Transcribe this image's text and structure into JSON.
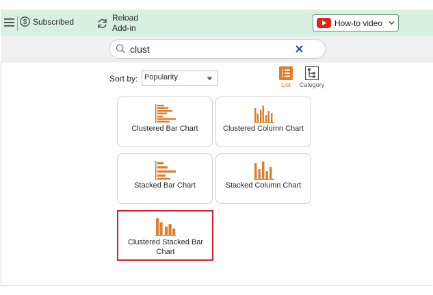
{
  "toolbar": {
    "subscribed_label": "Subscribed",
    "reload_label_line1": "Reload",
    "reload_label_line2": "Add-in",
    "howto_label": "How-to video"
  },
  "search": {
    "value": "clust",
    "placeholder": ""
  },
  "sort": {
    "label": "Sort by:",
    "selected": "Popularity"
  },
  "view": {
    "list_label": "List",
    "category_label": "Category",
    "active": "List"
  },
  "charts": [
    {
      "label": "Clustered Bar Chart",
      "icon": "clustered-bar-chart-icon"
    },
    {
      "label": "Clustered Column Chart",
      "icon": "clustered-column-chart-icon"
    },
    {
      "label": "Stacked Bar Chart",
      "icon": "stacked-bar-chart-icon"
    },
    {
      "label": "Stacked Column Chart",
      "icon": "stacked-column-chart-icon"
    },
    {
      "label": "Clustered Stacked Bar Chart",
      "icon": "clustered-stacked-bar-chart-icon",
      "selected": true
    }
  ],
  "colors": {
    "accent": "#e07b2c",
    "toolbar_bg": "#d7f0e2",
    "selection": "#d32027",
    "youtube": "#e62117"
  }
}
